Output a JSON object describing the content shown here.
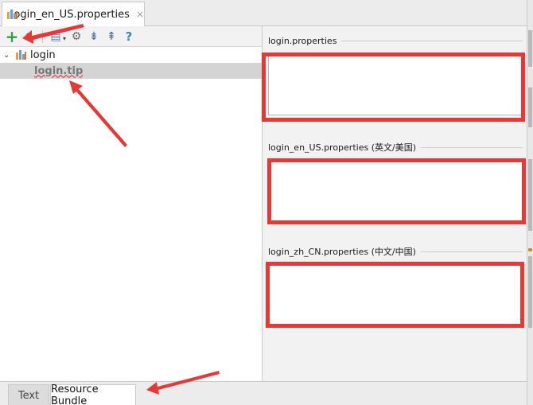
{
  "editor_tab": {
    "title": "login_en_US.properties",
    "close_glyph": "×",
    "icon": "resource-bundle-icon"
  },
  "toolbar": {
    "buttons": [
      {
        "name": "add-property-button",
        "glyph": "+"
      },
      {
        "name": "sort-button",
        "glyph": "⇅"
      },
      {
        "name": "group-by-prefix-button",
        "glyph": "▤"
      },
      {
        "name": "settings-button",
        "glyph": "⚙"
      },
      {
        "name": "expand-all-button",
        "glyph": "⇟"
      },
      {
        "name": "collapse-all-button",
        "glyph": "⇞"
      },
      {
        "name": "help-button",
        "glyph": "?"
      }
    ]
  },
  "tree": {
    "root": {
      "label": "login",
      "chevron": "⌄"
    },
    "child": {
      "label": "login.tip"
    }
  },
  "right_pane": {
    "sections": [
      {
        "title": "login.properties"
      },
      {
        "title": "login_en_US.properties (英文/美国)"
      },
      {
        "title": "login_zh_CN.properties (中文/中国)"
      }
    ]
  },
  "bottom_tabs": {
    "text": "Text",
    "resource_bundle": "Resource Bundle"
  },
  "colors": {
    "annotation_red": "#e53935",
    "add_green": "#2f9e44",
    "help_blue": "#3a84c9",
    "selection_gray": "#d4d4d4"
  }
}
